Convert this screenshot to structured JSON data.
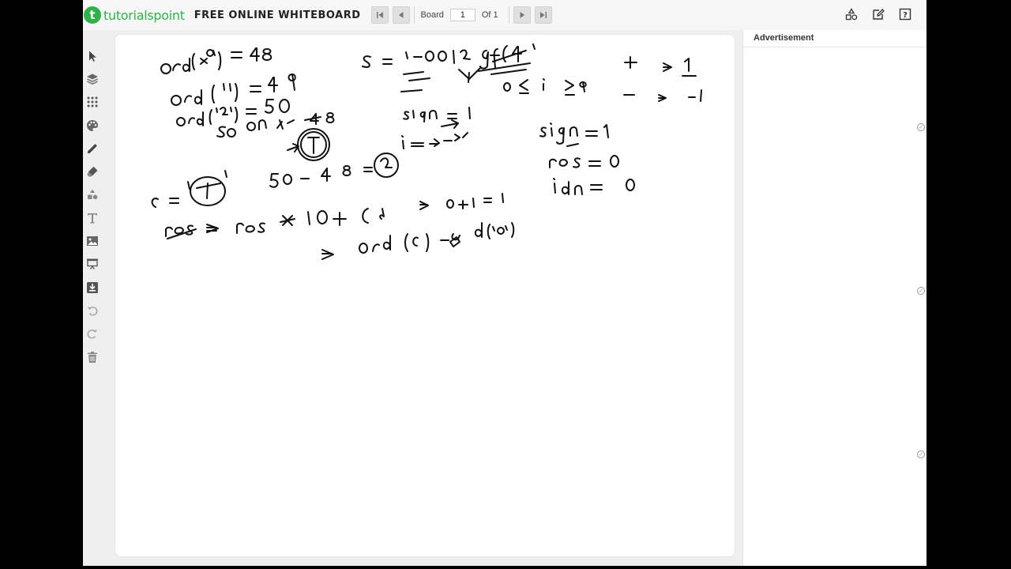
{
  "brand": {
    "logo_letter": "t",
    "name_part1": "tutorials",
    "name_part2": "point"
  },
  "app_title": "FREE ONLINE WHITEBOARD",
  "board": {
    "label": "Board",
    "current": "1",
    "of_label": "Of 1"
  },
  "toolbar": {
    "tools": [
      "select-tool",
      "layers-tool",
      "dots-tool",
      "palette-tool",
      "pen-tool",
      "eraser-tool",
      "shapes-tool",
      "text-tool",
      "image-tool",
      "presentation-tool",
      "download-tool",
      "undo-tool",
      "redo-tool",
      "delete-tool"
    ]
  },
  "right_tools": [
    "shapes-icon",
    "edit-icon",
    "help-icon"
  ],
  "ad": {
    "title": "Advertisement"
  },
  "colors": {
    "brand_green": "#2eb34a",
    "ink": "#111111",
    "canvas": "#ffffff",
    "app_bg": "#efefef"
  }
}
